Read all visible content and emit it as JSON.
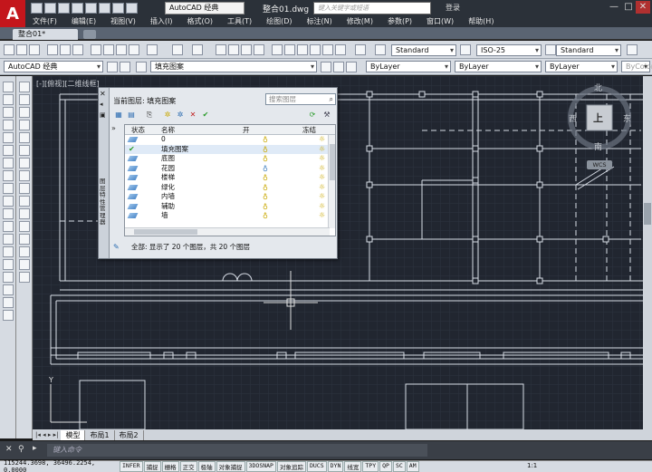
{
  "window": {
    "title": "整合01.dwg",
    "workspace": "AutoCAD 经典",
    "help_search_placeholder": "键入关键字或短语",
    "login_label": "登录"
  },
  "menu": [
    "文件(F)",
    "编辑(E)",
    "视图(V)",
    "插入(I)",
    "格式(O)",
    "工具(T)",
    "绘图(D)",
    "标注(N)",
    "修改(M)",
    "参数(P)",
    "窗口(W)",
    "帮助(H)"
  ],
  "doc_tab": "整合01*",
  "toolbar": {
    "text_style": "Standard",
    "dim_style": "ISO-25",
    "table_style": "Standard",
    "workspace2": "AutoCAD 经典",
    "layer_combo": "填充图案",
    "color_combo": "ByLayer",
    "linetype_combo": "ByLayer",
    "lineweight_combo": "ByLayer",
    "plotstyle_combo": "ByColor"
  },
  "canvas": {
    "viewport_label": "[-][俯视][二维线框]",
    "viewcube": {
      "north": "北",
      "south": "南",
      "east": "东",
      "west": "西",
      "top": "上",
      "wcs": "WCS"
    }
  },
  "layer_palette": {
    "side_title": "图层特性管理器",
    "current_layer_label": "当前图层: 填充图案",
    "search_placeholder": "搜索图层",
    "columns": {
      "status": "状态",
      "name": "名称",
      "on": "开",
      "freeze": "冻结"
    },
    "rows": [
      {
        "name": "0",
        "current": false
      },
      {
        "name": "填充图案",
        "current": true
      },
      {
        "name": "底图",
        "current": false
      },
      {
        "name": "花园",
        "current": false
      },
      {
        "name": "楼梯",
        "current": false
      },
      {
        "name": "绿化",
        "current": false
      },
      {
        "name": "内墙",
        "current": false
      },
      {
        "name": "辅助",
        "current": false
      },
      {
        "name": "墙",
        "current": false
      }
    ],
    "footer": "全部: 显示了 20 个图层，共 20 个图层"
  },
  "layout_tabs": [
    "模型",
    "布局1",
    "布局2"
  ],
  "command_line": {
    "placeholder": "键入命令"
  },
  "status_bar": {
    "coords": "115244.3698, 36496.2254, 0.0000",
    "toggles": [
      "INFER",
      "捕捉",
      "栅格",
      "正交",
      "极轴",
      "对象捕捉",
      "3DOSNAP",
      "对象追踪",
      "DUCS",
      "DYN",
      "线宽",
      "TPY",
      "QP",
      "SC",
      "AM"
    ],
    "scale": "1:1"
  },
  "colors": {
    "canvas_bg": "#212630",
    "drawing_line": "#d8dde6",
    "grid": "#2d3440"
  }
}
